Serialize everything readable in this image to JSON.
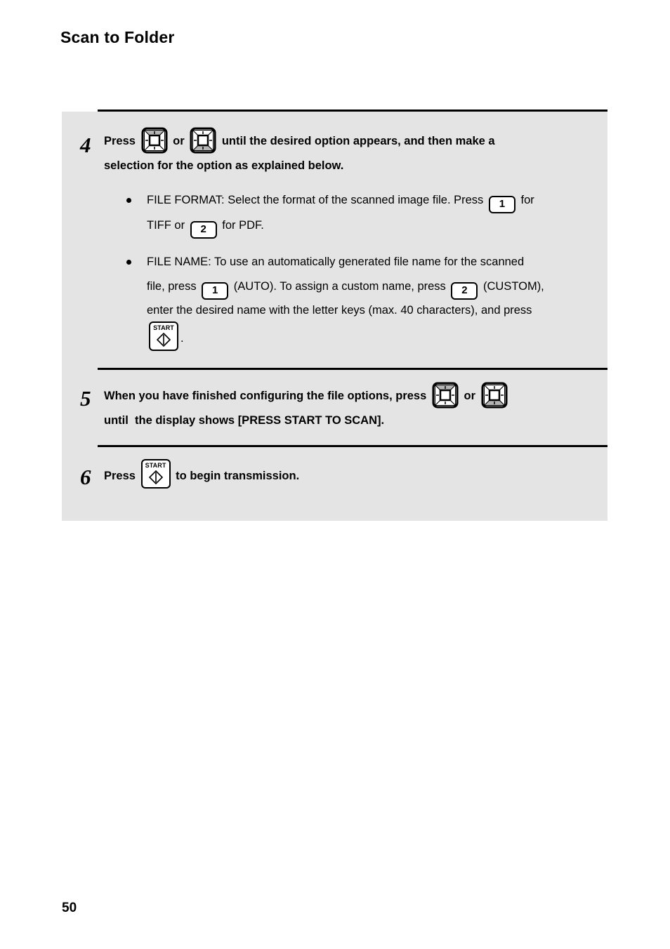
{
  "document": {
    "title": "Scan to Folder",
    "page_number": "50"
  },
  "steps": [
    {
      "number": "4",
      "line1_part1": "Press",
      "icon1": "up-arrow-key-icon",
      "line1_part2": "or",
      "icon2": "down-arrow-key-icon",
      "line1_part3": "until the desired option appears, and then make a",
      "line2": "selection for the option as explained below.",
      "bullets": [
        {
          "seg1": "FILE FORMAT: Select the format of the scanned image file. Press",
          "key1": "1",
          "seg2": "for",
          "seg3": "TIFF or",
          "key2": "2",
          "seg4": "for PDF."
        },
        {
          "seg1": "FILE NAME: To use an automatically generated file name for the scanned",
          "seg2": "file, press",
          "key1": "1",
          "seg3": "(AUTO). To assign a custom name, press",
          "key2": "2",
          "seg4": "(CUSTOM),",
          "seg5": "enter the desired name with the letter keys (max. 40 characters), and press",
          "key3_label": "START",
          "seg6": "."
        }
      ]
    },
    {
      "number": "5",
      "line1_part1": "When you have finished configuring the file options, press",
      "icon1": "up-arrow-key-icon",
      "line1_part2": "or",
      "icon2": "down-arrow-key-icon",
      "line2": "until  the display shows [PRESS START TO SCAN]."
    },
    {
      "number": "6",
      "line1_part1": "Press",
      "key_label": "START",
      "line1_part2": "to begin transmission."
    }
  ],
  "colors": {
    "panel_background": "#e4e4e4",
    "page_background": "#ffffff",
    "text": "#000000",
    "rule": "#000000",
    "key_shade": "#b4b4b4"
  }
}
